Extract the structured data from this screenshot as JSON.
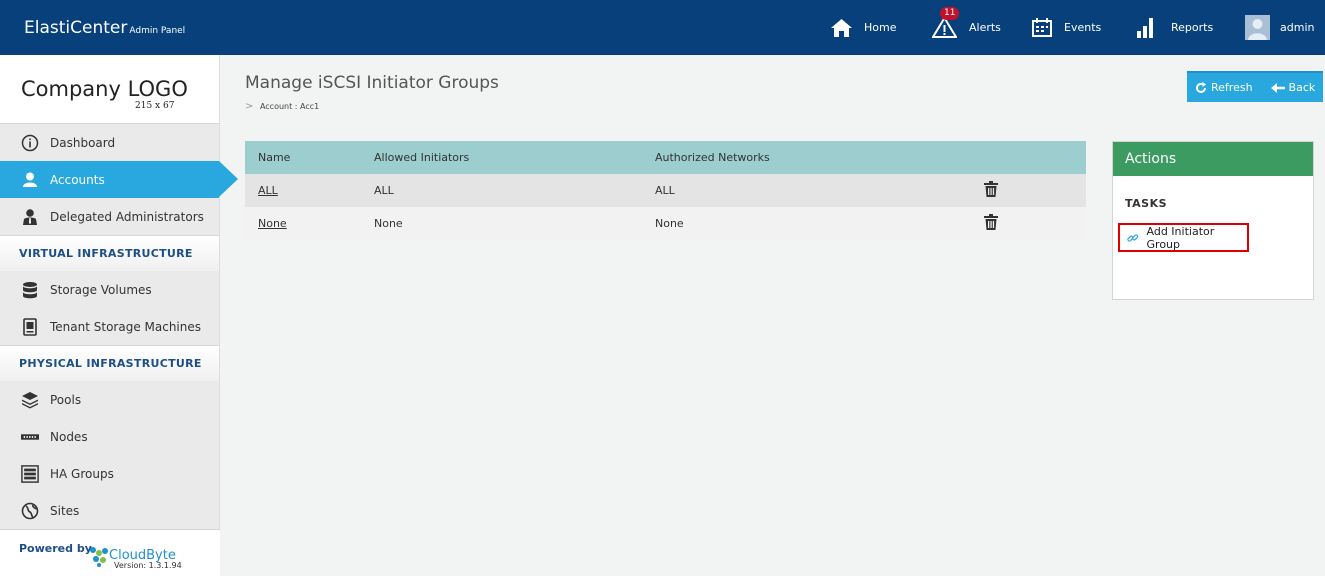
{
  "header": {
    "brand": "ElastiCenter",
    "brand_sub": "Admin Panel",
    "nav": {
      "home": "Home",
      "alerts": "Alerts",
      "alerts_count": "11",
      "events": "Events",
      "reports": "Reports",
      "user": "admin"
    }
  },
  "sidebar": {
    "logo": "Company LOGO",
    "logo_size": "215 x 67",
    "items": [
      {
        "label": "Dashboard",
        "icon": "info-icon"
      },
      {
        "label": "Accounts",
        "icon": "user-icon",
        "active": true
      },
      {
        "label": "Delegated Administrators",
        "icon": "admin-icon"
      }
    ],
    "section_virtual": "VIRTUAL INFRASTRUCTURE",
    "virtual_items": [
      {
        "label": "Storage Volumes",
        "icon": "database-icon"
      },
      {
        "label": "Tenant Storage Machines",
        "icon": "machine-icon"
      }
    ],
    "section_physical": "PHYSICAL INFRASTRUCTURE",
    "physical_items": [
      {
        "label": "Pools",
        "icon": "layers-icon"
      },
      {
        "label": "Nodes",
        "icon": "node-icon"
      },
      {
        "label": "HA Groups",
        "icon": "rack-icon"
      },
      {
        "label": "Sites",
        "icon": "globe-icon"
      }
    ],
    "powered_by": "Powered by",
    "vendor": "CloudByte",
    "version": "Version: 1.3.1.94"
  },
  "main": {
    "title": "Manage iSCSI Initiator Groups",
    "breadcrumb": "Account : Acc1",
    "refresh": "Refresh",
    "back": "Back",
    "columns": [
      "Name",
      "Allowed Initiators",
      "Authorized Networks"
    ],
    "rows": [
      {
        "name": "ALL",
        "initiators": "ALL",
        "networks": "ALL"
      },
      {
        "name": "None",
        "initiators": "None",
        "networks": "None"
      }
    ]
  },
  "actions": {
    "title": "Actions",
    "tasks_label": "TASKS",
    "add_group": "Add Initiator Group"
  },
  "colors": {
    "topbar": "#07407b",
    "accent": "#29a8e0",
    "actions_header": "#3c9b60",
    "grid_header": "#9ccdcf",
    "highlight": "#e00000"
  }
}
